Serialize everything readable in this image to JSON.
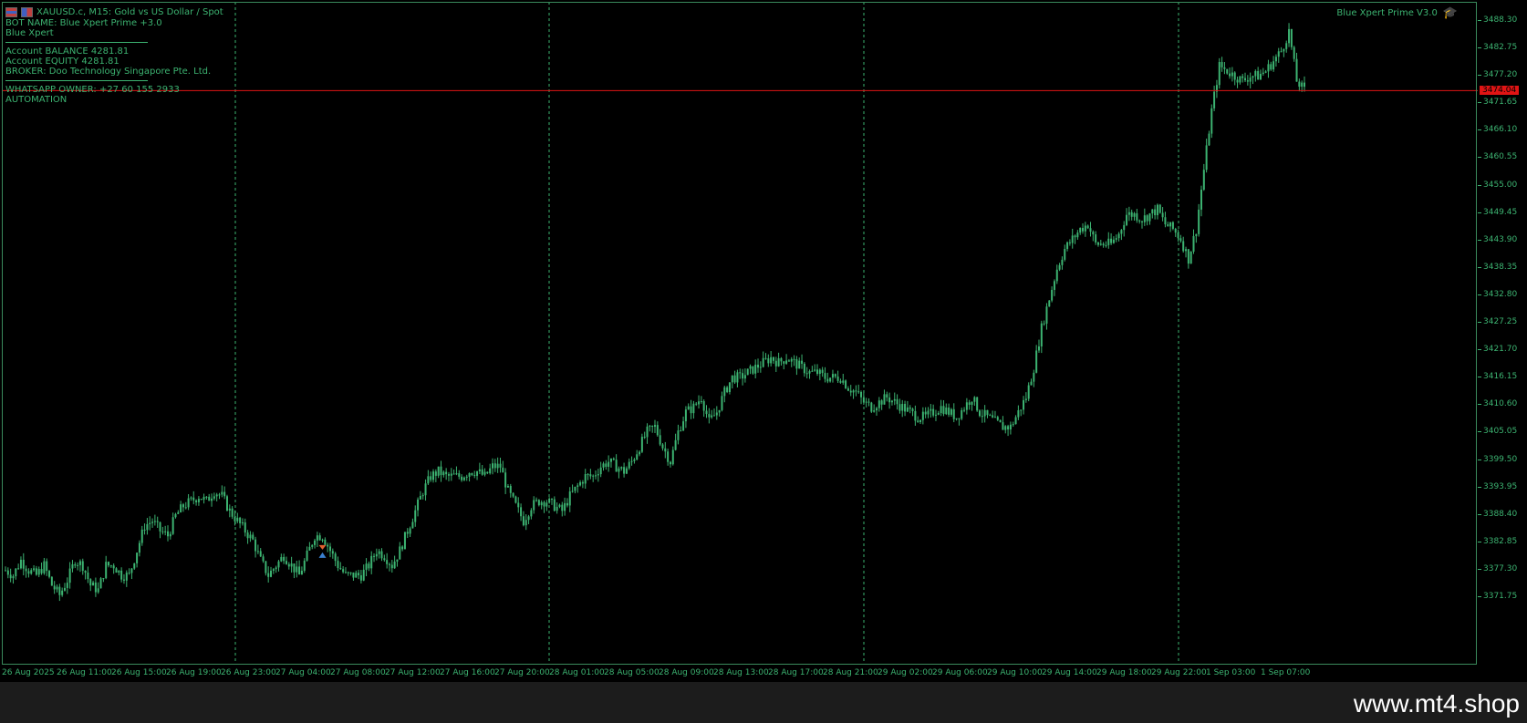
{
  "window": {
    "symbol_title": "XAUUSD.c, M15:  Gold vs US Dollar / Spot",
    "ea_name": "Blue Xpert Prime V3.0"
  },
  "info": {
    "bot_name": "BOT NAME: Blue Xpert Prime +3.0",
    "bot_short": "Blue Xpert",
    "balance": "Account BALANCE  4281.81",
    "equity": "Account EQUITY   4281.81",
    "broker": "BROKER: Doo Technology Singapore Pte. Ltd.",
    "whatsapp": "WHATSAPP OWNER: +27 60 155 2933",
    "automation": "AUTOMATION"
  },
  "icons": {
    "chart_type": "bar-chart-icon",
    "indicators": "indicator-icon",
    "ea": "graduation-cap-icon"
  },
  "colors": {
    "candle": "#3cb371",
    "price_line": "#e01414",
    "grid": "#3cb371",
    "background": "#000000"
  },
  "footer": {
    "watermark": "www.mt4.shop"
  },
  "chart_data": {
    "type": "candlestick",
    "price_ticks": [
      "3488.30",
      "3482.75",
      "3477.20",
      "3471.65",
      "3466.10",
      "3460.55",
      "3455.00",
      "3449.45",
      "3443.90",
      "3438.35",
      "3432.80",
      "3427.25",
      "3421.70",
      "3416.15",
      "3410.60",
      "3405.05",
      "3399.50",
      "3393.95",
      "3388.40",
      "3382.85",
      "3377.30",
      "3371.75"
    ],
    "current_price": "3474.04",
    "time_labels": [
      "26 Aug 2025",
      "26 Aug 11:00",
      "26 Aug 15:00",
      "26 Aug 19:00",
      "26 Aug 23:00",
      "27 Aug 04:00",
      "27 Aug 08:00",
      "27 Aug 12:00",
      "27 Aug 16:00",
      "27 Aug 20:00",
      "28 Aug 01:00",
      "28 Aug 05:00",
      "28 Aug 09:00",
      "28 Aug 13:00",
      "28 Aug 17:00",
      "28 Aug 21:00",
      "29 Aug 02:00",
      "29 Aug 06:00",
      "29 Aug 10:00",
      "29 Aug 14:00",
      "29 Aug 18:00",
      "29 Aug 22:00",
      "1 Sep 03:00",
      "1 Sep 07:00"
    ],
    "ylim": [
      3367.0,
      3490.5
    ],
    "price_path": [
      [
        0,
        3377
      ],
      [
        3,
        3376
      ],
      [
        6,
        3379
      ],
      [
        9,
        3377
      ],
      [
        12,
        3376
      ],
      [
        15,
        3378
      ],
      [
        18,
        3374
      ],
      [
        21,
        3372
      ],
      [
        24,
        3375
      ],
      [
        27,
        3379
      ],
      [
        30,
        3378
      ],
      [
        33,
        3374
      ],
      [
        36,
        3373
      ],
      [
        39,
        3378
      ],
      [
        42,
        3378
      ],
      [
        45,
        3376
      ],
      [
        48,
        3376
      ],
      [
        51,
        3381
      ],
      [
        54,
        3386
      ],
      [
        57,
        3387
      ],
      [
        60,
        3385
      ],
      [
        63,
        3384
      ],
      [
        66,
        3388
      ],
      [
        69,
        3390
      ],
      [
        72,
        3391
      ],
      [
        75,
        3392
      ],
      [
        78,
        3391
      ],
      [
        81,
        3393
      ],
      [
        84,
        3392
      ],
      [
        87,
        3389
      ],
      [
        90,
        3387
      ],
      [
        93,
        3385
      ],
      [
        96,
        3383
      ],
      [
        99,
        3379
      ],
      [
        102,
        3376
      ],
      [
        105,
        3378
      ],
      [
        108,
        3380
      ],
      [
        111,
        3378
      ],
      [
        114,
        3376
      ],
      [
        117,
        3380
      ],
      [
        120,
        3384
      ],
      [
        123,
        3384
      ],
      [
        126,
        3381
      ],
      [
        129,
        3378
      ],
      [
        132,
        3376
      ],
      [
        135,
        3376
      ],
      [
        138,
        3376
      ],
      [
        141,
        3378
      ],
      [
        144,
        3381
      ],
      [
        147,
        3380
      ],
      [
        150,
        3378
      ],
      [
        153,
        3381
      ],
      [
        156,
        3385
      ],
      [
        159,
        3389
      ],
      [
        162,
        3393
      ],
      [
        165,
        3396
      ],
      [
        168,
        3397
      ],
      [
        171,
        3396
      ],
      [
        174,
        3396
      ],
      [
        177,
        3396
      ],
      [
        180,
        3397
      ],
      [
        183,
        3397
      ],
      [
        186,
        3396
      ],
      [
        189,
        3398
      ],
      [
        192,
        3398
      ],
      [
        195,
        3393
      ],
      [
        198,
        3390
      ],
      [
        201,
        3387
      ],
      [
        204,
        3390
      ],
      [
        207,
        3391
      ],
      [
        210,
        3391
      ],
      [
        213,
        3390
      ],
      [
        216,
        3389
      ],
      [
        219,
        3392
      ],
      [
        222,
        3394
      ],
      [
        225,
        3396
      ],
      [
        228,
        3396
      ],
      [
        231,
        3398
      ],
      [
        234,
        3399
      ],
      [
        237,
        3398
      ],
      [
        240,
        3397
      ],
      [
        243,
        3399
      ],
      [
        246,
        3402
      ],
      [
        249,
        3405
      ],
      [
        252,
        3406
      ],
      [
        255,
        3402
      ],
      [
        258,
        3399
      ],
      [
        261,
        3405
      ],
      [
        264,
        3409
      ],
      [
        267,
        3410
      ],
      [
        270,
        3412
      ],
      [
        273,
        3407
      ],
      [
        276,
        3409
      ],
      [
        279,
        3413
      ],
      [
        282,
        3416
      ],
      [
        285,
        3416
      ],
      [
        288,
        3417
      ],
      [
        291,
        3418
      ],
      [
        294,
        3419
      ],
      [
        297,
        3420
      ],
      [
        300,
        3419
      ],
      [
        303,
        3420
      ],
      [
        306,
        3419
      ],
      [
        309,
        3418
      ],
      [
        312,
        3417
      ],
      [
        315,
        3417
      ],
      [
        318,
        3416
      ],
      [
        321,
        3416
      ],
      [
        324,
        3416
      ],
      [
        327,
        3414
      ],
      [
        330,
        3413
      ],
      [
        333,
        3411
      ],
      [
        336,
        3410
      ],
      [
        339,
        3411
      ],
      [
        342,
        3412
      ],
      [
        345,
        3411
      ],
      [
        348,
        3410
      ],
      [
        351,
        3409
      ],
      [
        354,
        3408
      ],
      [
        357,
        3408
      ],
      [
        360,
        3409
      ],
      [
        363,
        3410
      ],
      [
        366,
        3409
      ],
      [
        369,
        3408
      ],
      [
        372,
        3410
      ],
      [
        375,
        3412
      ],
      [
        378,
        3409
      ],
      [
        381,
        3408
      ],
      [
        384,
        3407
      ],
      [
        387,
        3406
      ],
      [
        390,
        3406
      ],
      [
        393,
        3409
      ],
      [
        396,
        3412
      ],
      [
        399,
        3418
      ],
      [
        402,
        3426
      ],
      [
        405,
        3432
      ],
      [
        408,
        3438
      ],
      [
        411,
        3442
      ],
      [
        414,
        3444
      ],
      [
        417,
        3446
      ],
      [
        420,
        3447
      ],
      [
        423,
        3443
      ],
      [
        426,
        3443
      ],
      [
        429,
        3443
      ],
      [
        432,
        3445
      ],
      [
        435,
        3449
      ],
      [
        438,
        3449
      ],
      [
        441,
        3448
      ],
      [
        444,
        3449
      ],
      [
        447,
        3450
      ],
      [
        450,
        3447
      ],
      [
        453,
        3446
      ],
      [
        456,
        3444
      ],
      [
        459,
        3440
      ],
      [
        462,
        3446
      ],
      [
        465,
        3458
      ],
      [
        468,
        3470
      ],
      [
        471,
        3479
      ],
      [
        474,
        3478
      ],
      [
        477,
        3477
      ],
      [
        480,
        3476
      ],
      [
        483,
        3477
      ],
      [
        486,
        3477
      ],
      [
        489,
        3478
      ],
      [
        492,
        3480
      ],
      [
        495,
        3482
      ],
      [
        498,
        3486
      ],
      [
        501,
        3476
      ],
      [
        504,
        3474
      ]
    ],
    "trade_marker": {
      "index": 123,
      "price": 3381
    }
  }
}
